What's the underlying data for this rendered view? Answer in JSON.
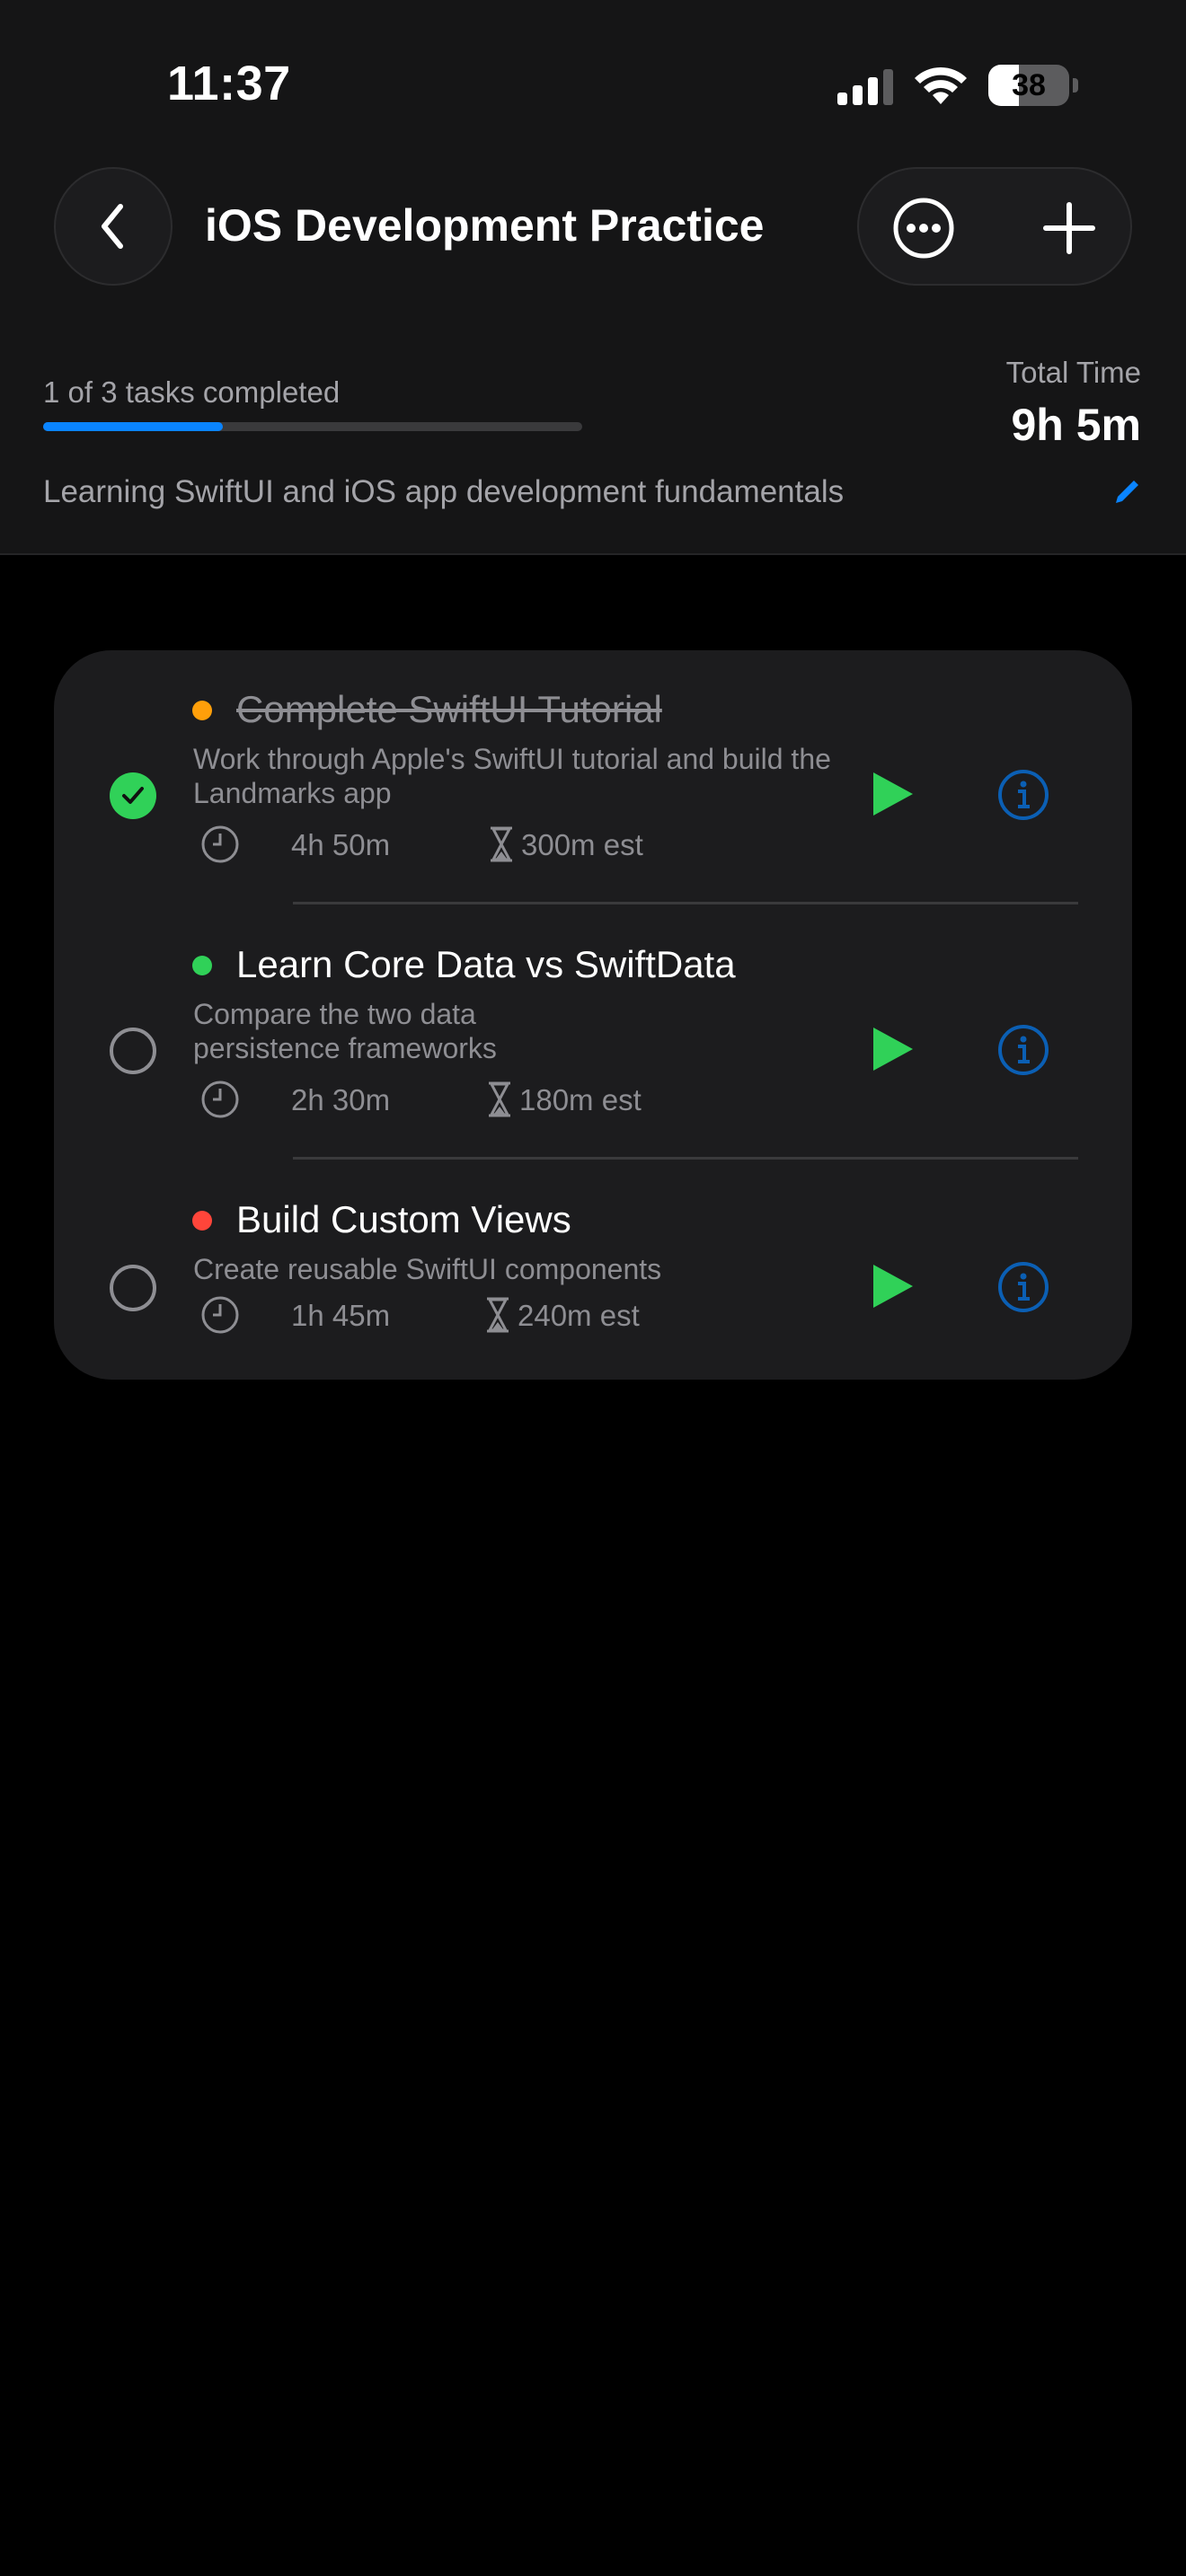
{
  "status_bar": {
    "time": "11:37",
    "battery": "38",
    "battery_level": 0.38
  },
  "header": {
    "back_icon": "chevron-left-icon",
    "title": "iOS Development Practice",
    "more_icon": "ellipsis-circle-icon",
    "add_icon": "plus-icon"
  },
  "progress": {
    "label": "1 of 3 tasks completed",
    "fraction": 0.333,
    "total_time_label": "Total Time",
    "total_time_value": "9h 5m",
    "description": "Learning SwiftUI and iOS app development fundamentals",
    "edit_icon": "pencil-icon"
  },
  "colors": {
    "accent": "#0a84ff",
    "green": "#30d158",
    "priority_medium": "#ff9f0a",
    "priority_low": "#30d158",
    "priority_high": "#ff453a",
    "info_blue": "#0b5fb4"
  },
  "tasks": [
    {
      "title": "Complete SwiftUI Tutorial",
      "description": "Work through Apple's SwiftUI tutorial and build the Landmarks app",
      "time_spent": "4h 50m",
      "estimate": "300m est",
      "completed": true,
      "priority_color": "#ff9f0a"
    },
    {
      "title": "Learn Core Data vs SwiftData",
      "description": "Compare the two data persistence frameworks",
      "time_spent": "2h 30m",
      "estimate": "180m est",
      "completed": false,
      "priority_color": "#30d158"
    },
    {
      "title": "Build Custom Views",
      "description": "Create reusable SwiftUI components",
      "time_spent": "1h 45m",
      "estimate": "240m est",
      "completed": false,
      "priority_color": "#ff453a"
    }
  ]
}
